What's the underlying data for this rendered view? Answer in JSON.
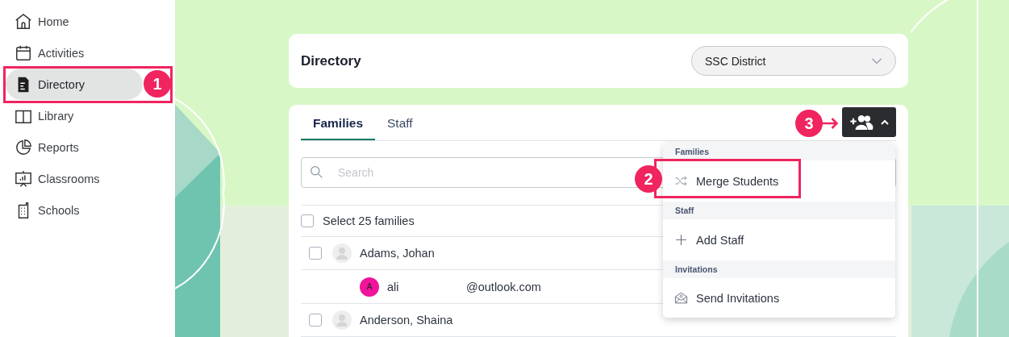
{
  "sidebar": {
    "items": [
      {
        "label": "Home",
        "selected": false
      },
      {
        "label": "Activities",
        "selected": false
      },
      {
        "label": "Directory",
        "selected": true
      },
      {
        "label": "Library",
        "selected": false
      },
      {
        "label": "Reports",
        "selected": false
      },
      {
        "label": "Classrooms",
        "selected": false
      },
      {
        "label": "Schools",
        "selected": false
      }
    ]
  },
  "header": {
    "title": "Directory",
    "district_select": {
      "value": "SSC District"
    }
  },
  "tabs": [
    {
      "label": "Families",
      "selected": true
    },
    {
      "label": "Staff",
      "selected": false
    }
  ],
  "search": {
    "placeholder": "Search"
  },
  "select_all": {
    "label": "Select 25 families",
    "checked": false
  },
  "families": [
    {
      "name": "Adams, Johan",
      "checked": false,
      "guardians": [
        {
          "initial": "A",
          "name": "ali",
          "email": "@outlook.com",
          "color": "#f0149a"
        }
      ]
    },
    {
      "name": "Anderson, Shaina",
      "checked": false
    }
  ],
  "menu": {
    "sections": [
      {
        "heading": "Families",
        "items": [
          {
            "label": "Merge Students"
          }
        ]
      },
      {
        "heading": "Staff",
        "items": [
          {
            "label": "Add Staff"
          }
        ]
      },
      {
        "heading": "Invitations",
        "items": [
          {
            "label": "Send Invitations"
          }
        ]
      }
    ]
  },
  "annotations": [
    {
      "number": "1"
    },
    {
      "number": "2"
    },
    {
      "number": "3"
    }
  ]
}
